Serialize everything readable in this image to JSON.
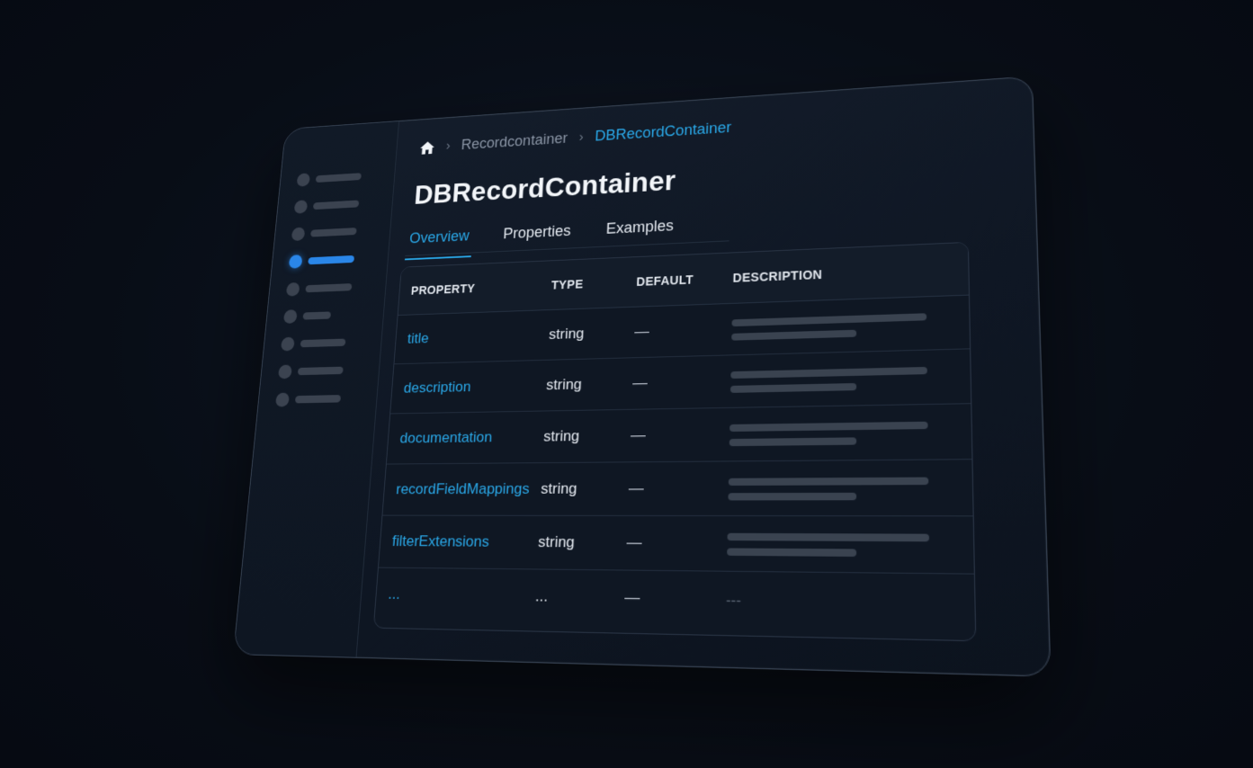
{
  "breadcrumb": {
    "home_icon": "home-icon",
    "separator": "›",
    "items": [
      "Recordcontainer",
      "DBRecordContainer"
    ]
  },
  "page": {
    "title": "DBRecordContainer"
  },
  "tabs": [
    {
      "label": "Overview",
      "active": true
    },
    {
      "label": "Properties",
      "active": false
    },
    {
      "label": "Examples",
      "active": false
    }
  ],
  "table": {
    "headers": {
      "property": "PROPERTY",
      "type": "TYPE",
      "default": "DEFAULT",
      "description": "DESCRIPTION"
    },
    "rows": [
      {
        "property": "title",
        "type": "string",
        "default": "—"
      },
      {
        "property": "description",
        "type": "string",
        "default": "—"
      },
      {
        "property": "documentation",
        "type": "string",
        "default": "—"
      },
      {
        "property": "recordFieldMappings",
        "type": "string",
        "default": "—"
      },
      {
        "property": "filterExtensions",
        "type": "string",
        "default": "—"
      },
      {
        "property": "...",
        "type": "...",
        "default": "—",
        "description": "---"
      }
    ]
  },
  "colors": {
    "accent": "#2aa8e8",
    "active_nav": "#2a86e8",
    "background": "#080d16"
  }
}
